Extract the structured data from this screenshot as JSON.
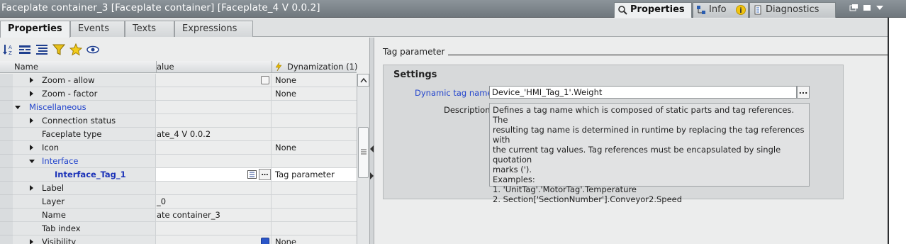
{
  "window": {
    "title": "Faceplate container_3 [Faceplate container] [Faceplate_4 V 0.0.2]",
    "tabs": [
      {
        "label": "Properties",
        "icon": "properties-icon"
      },
      {
        "label": "Info",
        "icon": "info-icon"
      },
      {
        "label": "Diagnostics",
        "icon": "diagnostics-icon"
      }
    ]
  },
  "subtabs": [
    "Properties",
    "Events",
    "Texts",
    "Expressions"
  ],
  "toolbar": {
    "icons": [
      "sort-az-icon",
      "collapse-icon",
      "expand-icon",
      "filter-icon",
      "favorite-star-icon",
      "view-eye-icon"
    ]
  },
  "grid": {
    "headers": {
      "name": "Name",
      "value": "alue",
      "dynamization": "Dynamization (1)"
    },
    "rows": [
      {
        "name": "Zoom - allow",
        "value": "",
        "dyn": "None",
        "checkbox": true,
        "checked": false
      },
      {
        "name": "Zoom - factor",
        "value": "",
        "dyn": "None"
      },
      {
        "name": "Miscellaneous",
        "value": "",
        "dyn": ""
      },
      {
        "name": "Connection status",
        "value": "",
        "dyn": ""
      },
      {
        "name": "Faceplate type",
        "value": "ate_4 V 0.0.2",
        "dyn": ""
      },
      {
        "name": "Icon",
        "value": "",
        "dyn": "None"
      },
      {
        "name": "Interface",
        "value": "",
        "dyn": ""
      },
      {
        "name": "Interface_Tag_1",
        "value": "",
        "dyn": "Tag parameter"
      },
      {
        "name": "Label",
        "value": "",
        "dyn": ""
      },
      {
        "name": "Layer",
        "value": "_0",
        "dyn": ""
      },
      {
        "name": "Name",
        "value": "ate container_3",
        "dyn": ""
      },
      {
        "name": "Tab index",
        "value": "",
        "dyn": ""
      },
      {
        "name": "Visibility",
        "value": "",
        "dyn": "None",
        "checkbox": true,
        "checked": true
      }
    ]
  },
  "right": {
    "section_title": "Tag parameter",
    "settings_title": "Settings",
    "dynamic_tag_label": "Dynamic tag name:",
    "dynamic_tag_value": "Device_'HMI_Tag_1'.Weight",
    "dots_label": "...",
    "description_label": "Description:",
    "description_lines": [
      "Defines a tag name which is composed of static parts and tag references. The",
      "resulting tag name is determined in runtime by replacing the tag references with",
      "the current tag values. Tag references must be encapsulated by single quotation",
      "marks (').",
      "Examples:",
      "1. 'UnitTag'.'MotorTag'.Temperature",
      "2. Section['SectionNumber'].Conveyor2.Speed"
    ]
  },
  "colors": {
    "link": "#2244cc",
    "titlebar": "#7b8389",
    "accent_checkbox": "#2b56c8"
  }
}
